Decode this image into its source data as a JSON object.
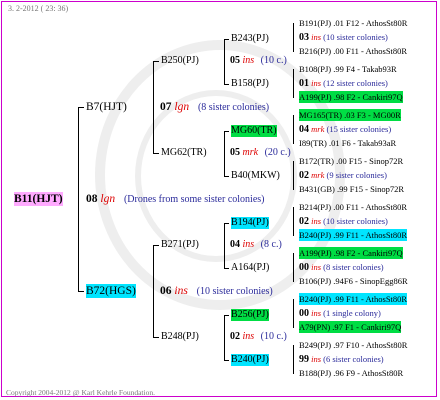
{
  "header": "3.  2-2012  ( 23: 36)",
  "footer": "Copyright 2004-2012 @ Karl Kehrle Foundation.",
  "root": {
    "name": "B11(HJT)",
    "year": "08",
    "ins": "lgn",
    "note": "(Drones from some sister colonies)"
  },
  "gen1": [
    {
      "name": "B7(HJT)",
      "year": "07",
      "ins": "lgn",
      "note": "(8 sister colonies)"
    },
    {
      "name": "B72(HGS)",
      "year": "06",
      "ins": "ins",
      "note": "(10 sister colonies)"
    }
  ],
  "gen2": [
    {
      "name": "B250(PJ)",
      "year": "05",
      "ins": "ins",
      "note": "(10 c.)"
    },
    {
      "name": "MG62(TR)",
      "year": "05",
      "ins": "mrk",
      "note": "(20 c.)"
    },
    {
      "name": "B271(PJ)",
      "year": "04",
      "ins": "ins",
      "note": "(8 c.)"
    },
    {
      "name": "B248(PJ)",
      "year": "02",
      "ins": "ins",
      "note": "(10 c.)"
    }
  ],
  "gen3": [
    {
      "name": "B243(PJ)"
    },
    {
      "name": "B158(PJ)"
    },
    {
      "name": "MG60(TR)"
    },
    {
      "name": "B40(MKW)"
    },
    {
      "name": "B194(PJ)"
    },
    {
      "name": "A164(PJ)"
    },
    {
      "name": "B256(PJ)"
    },
    {
      "name": "B240(PJ)"
    }
  ],
  "gen4": [
    {
      "top": "B191(PJ) .01 F12 - AthosSt80R",
      "mid_year": "03",
      "mid_ins": "ins",
      "mid_note": "(10 sister colonies)",
      "bot": "B216(PJ) .00 F11 - AthosSt80R"
    },
    {
      "top": "B108(PJ) .99    F4 - Takab93R",
      "mid_year": "01",
      "mid_ins": "ins",
      "mid_note": "(12 sister colonies)",
      "bot": "A199(PJ) .98    F2 - Cankiri97Q"
    },
    {
      "top": "MG165(TR) .03     F3 - MG00R",
      "mid_year": "04",
      "mid_ins": "mrk",
      "mid_note": "(15 sister colonies)",
      "bot": "I89(TR) .01    F6 - Takab93aR"
    },
    {
      "top": "B172(TR) .00   F15 - Sinop72R",
      "mid_year": "02",
      "mid_ins": "mrk",
      "mid_note": "(9 sister colonies)",
      "bot": "B431(GB) .99   F15 - Sinop72R"
    },
    {
      "top": "B214(PJ) .00 F11 - AthosSt80R",
      "mid_year": "02",
      "mid_ins": "ins",
      "mid_note": "(10 sister colonies)",
      "bot": "B240(PJ) .99 F11 - AthosSt80R"
    },
    {
      "top": "A199(PJ) .98    F2 - Cankiri97Q",
      "mid_year": "00",
      "mid_ins": "ins",
      "mid_note": "(8 sister colonies)",
      "bot": "B106(PJ) .94F6 - SinopEgg86R"
    },
    {
      "top": "B240(PJ) .99 F11 - AthosSt80R",
      "mid_year": "00",
      "mid_ins": "ins",
      "mid_note": "(1 single colony)",
      "bot": "A79(PN) .97    F1 - Cankiri97Q"
    },
    {
      "top": "B249(PJ) .97 F10 - AthosSt80R",
      "mid_year": "99",
      "mid_ins": "ins",
      "mid_note": "(6 sister colonies)",
      "bot": "B188(PJ) .96    F9 - AthosSt80R"
    }
  ]
}
